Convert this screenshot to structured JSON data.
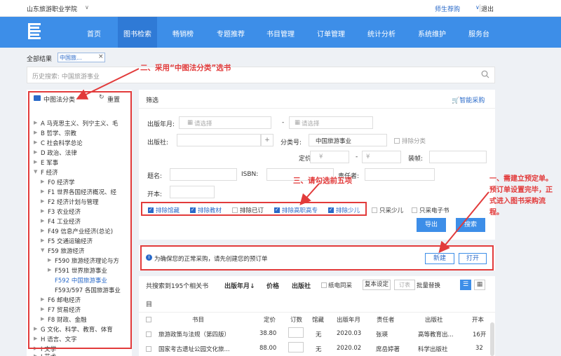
{
  "topbar": {
    "school": "山东旅游职业学院",
    "role": "师生荐购",
    "logout": "退出"
  },
  "nav": {
    "items": [
      "首页",
      "图书检索",
      "畅销榜",
      "专题推荐",
      "书目管理",
      "订单管理",
      "统计分析",
      "系统维护",
      "服务台"
    ],
    "active_index": 1
  },
  "breadcrumb": {
    "all": "全部结果",
    "tag": "中国旅...",
    "close": "×"
  },
  "history": {
    "label": "历史搜索:",
    "value": "中国旅游事业"
  },
  "left": {
    "header": "中图法分类",
    "reset": "重置",
    "tree": [
      {
        "label": "A 马克思主义、列宁主义、毛"
      },
      {
        "label": "B 哲学、宗教"
      },
      {
        "label": "C 社会科学总论"
      },
      {
        "label": "D 政治、法律"
      },
      {
        "label": "E 军事"
      },
      {
        "label": "F 经济"
      },
      {
        "label": "F0 经济学"
      },
      {
        "label": "F1 世界各国经济概况、经"
      },
      {
        "label": "F2 经济计划与管理"
      },
      {
        "label": "F3 农业经济"
      },
      {
        "label": "F4 工业经济"
      },
      {
        "label": "F49 信息产业经济(总论)"
      },
      {
        "label": "F5 交通运输经济"
      },
      {
        "label": "F59 旅游经济"
      },
      {
        "label": "F590 旅游经济理论与方"
      },
      {
        "label": "F591 世界旅游事业"
      },
      {
        "label": "F592 中国旅游事业"
      },
      {
        "label": "F593/597 各国旅游事业"
      },
      {
        "label": "F6 邮电经济"
      },
      {
        "label": "F7 贸易经济"
      },
      {
        "label": "F8 财政、金融"
      },
      {
        "label": "G 文化、科学、教育、体育"
      },
      {
        "label": "H 语言、文字"
      },
      {
        "label": "I 文学"
      },
      {
        "label": "J 艺术"
      }
    ]
  },
  "filter": {
    "title": "筛选",
    "smart_buy": "智能采购",
    "pub_date_label": "出版年月:",
    "date_placeholder": "请选择",
    "dash": "-",
    "publisher_label": "出版社:",
    "plus": "+",
    "class_label": "分类号:",
    "class_value": "中国旅游事业",
    "exclude_class": "排除分类",
    "price_label": "定价:",
    "currency": "¥",
    "binding_label": "装帧:",
    "title_label": "题名:",
    "isbn_label": "ISBN:",
    "responsible_label": "责任者:",
    "format_label": "开本:",
    "checks": [
      {
        "label": "排除馆藏",
        "on": true
      },
      {
        "label": "排除教材",
        "on": true
      },
      {
        "label": "排除已订",
        "on": false
      },
      {
        "label": "排除高职高专",
        "on": true
      },
      {
        "label": "排除少儿",
        "on": true
      },
      {
        "label": "只采少儿",
        "on": false
      },
      {
        "label": "只采电子书",
        "on": false
      }
    ],
    "export": "导出",
    "search": "搜索"
  },
  "notice": {
    "text": "为确保您的正常采购，请先创建您的预订单",
    "new": "新建",
    "open": "打开"
  },
  "results": {
    "count_text": "共搜索到195个相关书",
    "sort_date": "出版年月↓",
    "sort_price": "价格",
    "sort_publisher": "出版社",
    "paper_same": "纸电同采",
    "copy_settings": "复本设定",
    "order_placeholder": "订表",
    "batch_replace": "批量替换",
    "extra": "目",
    "headers": [
      "书目",
      "定价",
      "订数",
      "馆藏",
      "出版年月",
      "责任者",
      "出版社",
      "开本"
    ],
    "rows": [
      {
        "title": "旅游政策与法规（第四版）",
        "price": "38.80",
        "holding": "无",
        "date": "2020.03",
        "author": "张瑛",
        "publisher": "高等教育出...",
        "format": "16开"
      },
      {
        "title": "国家考古遗址公园文化旅...",
        "price": "88.00",
        "holding": "无",
        "date": "2020.02",
        "author": "席岳婷著",
        "publisher": "科学出版社",
        "format": "32"
      }
    ]
  },
  "annotations": {
    "a1": "二、采用“中图法分类”选书",
    "a2": "三、请勾选前五项",
    "a3": "一、需建立预定单。预订单设置完毕，正式进入图书采购流程。"
  },
  "colors": {
    "nav": "#3d8ee8",
    "accent": "#2a6ac9",
    "annotation": "#e23b3b"
  }
}
